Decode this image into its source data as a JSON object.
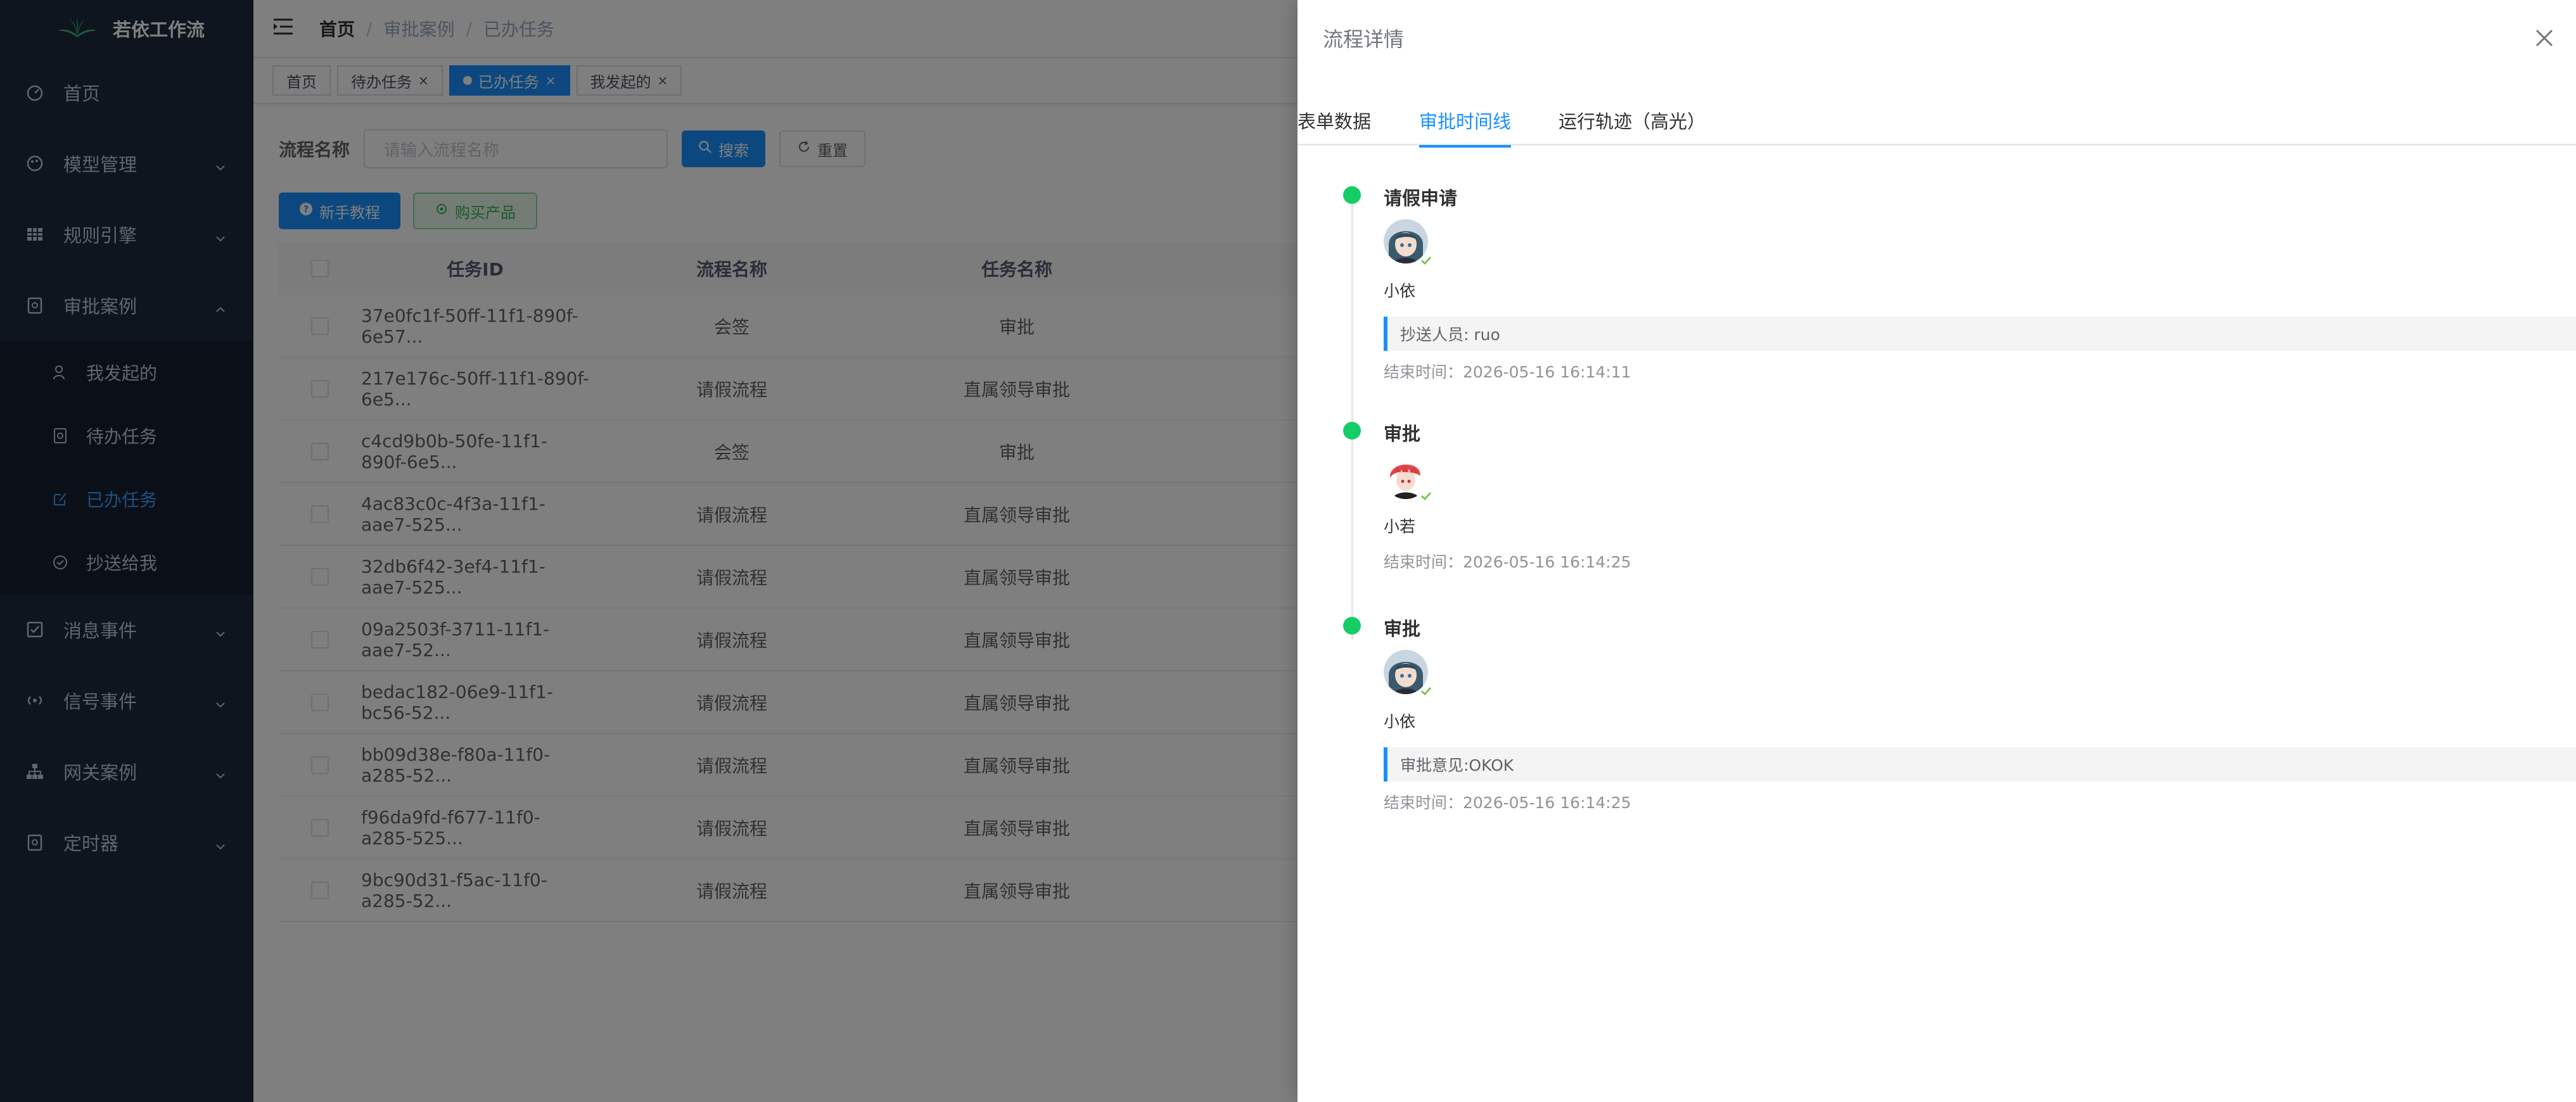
{
  "app": {
    "logo_title": "若依工作流"
  },
  "sidebar": {
    "items": [
      {
        "label": "首页",
        "icon": "dashboard-icon"
      },
      {
        "label": "模型管理",
        "icon": "palette-icon"
      },
      {
        "label": "规则引擎",
        "icon": "grid-icon"
      },
      {
        "label": "审批案例",
        "icon": "clipboard-icon"
      },
      {
        "label": "消息事件",
        "icon": "checkbox-icon"
      },
      {
        "label": "信号事件",
        "icon": "signal-icon"
      },
      {
        "label": "网关案例",
        "icon": "tree-icon"
      },
      {
        "label": "定时器",
        "icon": "clipboard-icon"
      }
    ],
    "sub_items": [
      {
        "label": "我发起的",
        "icon": "user-icon"
      },
      {
        "label": "待办任务",
        "icon": "clipboard-icon"
      },
      {
        "label": "已办任务",
        "icon": "edit-icon",
        "active": true
      },
      {
        "label": "抄送给我",
        "icon": "circle-check-icon"
      }
    ]
  },
  "navbar": {
    "breadcrumb": [
      "首页",
      "审批案例",
      "已办任务"
    ],
    "separator": "/"
  },
  "tags": [
    {
      "label": "首页"
    },
    {
      "label": "待办任务",
      "closable": true
    },
    {
      "label": "已办任务",
      "closable": true,
      "active": true
    },
    {
      "label": "我发起的",
      "closable": true
    }
  ],
  "tag_close": "×",
  "search": {
    "label": "流程名称",
    "placeholder": "请输入流程名称",
    "search_button": "搜索",
    "reset_button": "重置"
  },
  "actions": {
    "tutorial_button": "新手教程",
    "buy_button": "购买产品"
  },
  "table": {
    "headers": [
      "任务ID",
      "流程名称",
      "任务名称"
    ],
    "rows": [
      [
        "37e0fc1f-50ff-11f1-890f-6e57...",
        "会签",
        "审批"
      ],
      [
        "217e176c-50ff-11f1-890f-6e5...",
        "请假流程",
        "直属领导审批"
      ],
      [
        "c4cd9b0b-50fe-11f1-890f-6e5...",
        "会签",
        "审批"
      ],
      [
        "4ac83c0c-4f3a-11f1-aae7-525...",
        "请假流程",
        "直属领导审批"
      ],
      [
        "32db6f42-3ef4-11f1-aae7-525...",
        "请假流程",
        "直属领导审批"
      ],
      [
        "09a2503f-3711-11f1-aae7-52...",
        "请假流程",
        "直属领导审批"
      ],
      [
        "bedac182-06e9-11f1-bc56-52...",
        "请假流程",
        "直属领导审批"
      ],
      [
        "bb09d38e-f80a-11f0-a285-52...",
        "请假流程",
        "直属领导审批"
      ],
      [
        "f96da9fd-f677-11f0-a285-525...",
        "请假流程",
        "直属领导审批"
      ],
      [
        "9bc90d31-f5ac-11f0-a285-52...",
        "请假流程",
        "直属领导审批"
      ]
    ]
  },
  "drawer": {
    "title": "流程详情",
    "tabs": [
      {
        "label": "表单数据"
      },
      {
        "label": "审批时间线",
        "active": true
      },
      {
        "label": "运行轨迹（高光）"
      }
    ],
    "timeline": [
      {
        "title": "请假申请",
        "user": "小依",
        "note": "抄送人员: ruo",
        "time": "结束时间：2026-05-16 16:14:11"
      },
      {
        "title": "审批",
        "user": "小若",
        "time": "结束时间：2026-05-16 16:14:25"
      },
      {
        "title": "审批",
        "user": "小依",
        "note": "审批意见:OKOK",
        "time": "结束时间：2026-05-16 16:14:25"
      }
    ]
  },
  "colors": {
    "sidebar_bg": "#1e2a3d",
    "primary": "#1890ff",
    "success": "#13ce66"
  }
}
